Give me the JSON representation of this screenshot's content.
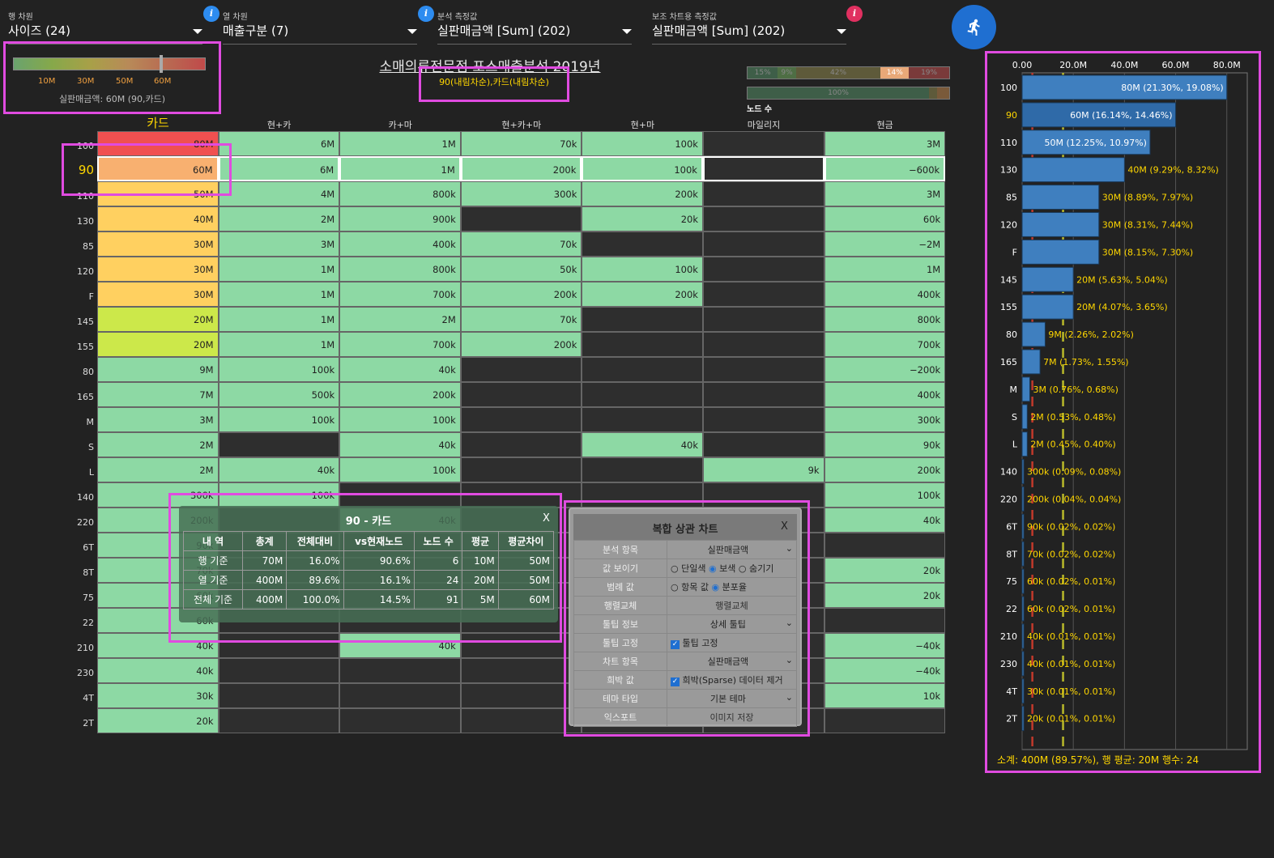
{
  "selectors": [
    {
      "label": "행 차원",
      "value": "사이즈 (24)"
    },
    {
      "label": "열 차원",
      "value": "매출구분 (7)"
    },
    {
      "label": "분석 측정값",
      "value": "실판매금액 [Sum] (202)"
    },
    {
      "label": "보조 차트용 측정값",
      "value": "실판매금액 [Sum] (202)"
    }
  ],
  "info_icon": "i",
  "legend": {
    "ticks": [
      "10M",
      "30M",
      "50M",
      "60M"
    ],
    "caption": "실판매금액: 60M (90,카드)",
    "marker": 0.78
  },
  "title": "소매의류전문점 포스매출분석 2019년",
  "sort_label": "90(내림차순),카드(내림차순)",
  "mini_bar1": [
    "15%",
    "9%",
    "42%",
    "14%",
    "19%"
  ],
  "mini_bar2": [
    "100%"
  ],
  "node_count_label": "노드 수",
  "columns": [
    "카드",
    "현+카",
    "카+마",
    "현+카+마",
    "현+마",
    "마일리지",
    "현금"
  ],
  "rows": [
    {
      "l": "100",
      "v": [
        "80M",
        "6M",
        "1M",
        "70k",
        "100k",
        "",
        "3M"
      ]
    },
    {
      "l": "90",
      "v": [
        "60M",
        "6M",
        "1M",
        "200k",
        "100k",
        "",
        "−600k"
      ]
    },
    {
      "l": "110",
      "v": [
        "50M",
        "4M",
        "800k",
        "300k",
        "200k",
        "",
        "3M"
      ]
    },
    {
      "l": "130",
      "v": [
        "40M",
        "2M",
        "900k",
        "",
        "20k",
        "",
        "60k"
      ]
    },
    {
      "l": "85",
      "v": [
        "30M",
        "3M",
        "400k",
        "70k",
        "",
        "",
        "−2M"
      ]
    },
    {
      "l": "120",
      "v": [
        "30M",
        "1M",
        "800k",
        "50k",
        "100k",
        "",
        "1M"
      ]
    },
    {
      "l": "F",
      "v": [
        "30M",
        "1M",
        "700k",
        "200k",
        "200k",
        "",
        "400k"
      ]
    },
    {
      "l": "145",
      "v": [
        "20M",
        "1M",
        "2M",
        "70k",
        "",
        "",
        "800k"
      ]
    },
    {
      "l": "155",
      "v": [
        "20M",
        "1M",
        "700k",
        "200k",
        "",
        "",
        "700k"
      ]
    },
    {
      "l": "80",
      "v": [
        "9M",
        "100k",
        "40k",
        "",
        "",
        "",
        "−200k"
      ]
    },
    {
      "l": "165",
      "v": [
        "7M",
        "500k",
        "200k",
        "",
        "",
        "",
        "400k"
      ]
    },
    {
      "l": "M",
      "v": [
        "3M",
        "100k",
        "100k",
        "",
        "",
        "",
        "300k"
      ]
    },
    {
      "l": "S",
      "v": [
        "2M",
        "",
        "40k",
        "",
        "40k",
        "",
        "90k"
      ]
    },
    {
      "l": "L",
      "v": [
        "2M",
        "40k",
        "100k",
        "",
        "",
        "9k",
        "200k"
      ]
    },
    {
      "l": "140",
      "v": [
        "300k",
        "100k",
        "",
        "",
        "",
        "",
        "100k"
      ]
    },
    {
      "l": "220",
      "v": [
        "200k",
        "",
        "40k",
        "",
        "",
        "",
        "40k"
      ]
    },
    {
      "l": "6T",
      "v": [
        "90k",
        "",
        "",
        "",
        "",
        "",
        ""
      ]
    },
    {
      "l": "8T",
      "v": [
        "70k",
        "",
        "",
        "",
        "",
        "",
        "20k"
      ]
    },
    {
      "l": "75",
      "v": [
        "60k",
        "",
        "",
        "",
        "",
        "",
        "20k"
      ]
    },
    {
      "l": "22",
      "v": [
        "60k",
        "",
        "",
        "",
        "",
        "",
        ""
      ]
    },
    {
      "l": "210",
      "v": [
        "40k",
        "",
        "40k",
        "",
        "",
        "",
        "−40k"
      ]
    },
    {
      "l": "230",
      "v": [
        "40k",
        "",
        "",
        "",
        "",
        "",
        "−40k"
      ]
    },
    {
      "l": "4T",
      "v": [
        "30k",
        "",
        "",
        "",
        "",
        "",
        "10k"
      ]
    },
    {
      "l": "2T",
      "v": [
        "20k",
        "",
        "",
        "",
        "",
        "",
        ""
      ]
    }
  ],
  "tooltip": {
    "title": "90 - 카드",
    "close": "X",
    "headers": [
      "내 역",
      "총계",
      "전체대비",
      "vs현재노드",
      "노드 수",
      "평균",
      "평균차이"
    ],
    "rows": [
      [
        "행 기준",
        "70M",
        "16.0%",
        "90.6%",
        "6",
        "10M",
        "50M"
      ],
      [
        "열 기준",
        "400M",
        "89.6%",
        "16.1%",
        "24",
        "20M",
        "50M"
      ],
      [
        "전체 기준",
        "400M",
        "100.0%",
        "14.5%",
        "91",
        "5M",
        "60M"
      ]
    ]
  },
  "panel": {
    "title": "복합 상관 차트",
    "close": "X",
    "r_analysis": "분석 항목",
    "analysis": "실판매금액",
    "r_show": "값 보이기",
    "show_opts": [
      "단일색",
      "보색",
      "숨기기"
    ],
    "r_legend": "범례 값",
    "legend_opts": [
      "항목 값",
      "분포율"
    ],
    "r_swap": "행렬교체",
    "swap": "행렬교체",
    "r_tip": "툴팁 정보",
    "tip": "상세 툴팁",
    "r_fix": "툴팁 고정",
    "fix": "툴팁 고정",
    "r_chart": "차트 항목",
    "chart": "실판매금액",
    "r_sparse": "희박 값",
    "sparse": "희박(Sparse) 데이터 제거",
    "r_theme": "테마 타입",
    "theme": "기본 테마",
    "r_export": "익스포트",
    "export": "이미지 저장"
  },
  "chart_data": {
    "type": "bar",
    "orientation": "horizontal",
    "x_ticks": [
      "0.00",
      "20.0M",
      "40.0M",
      "60.0M",
      "80.0M"
    ],
    "xlim": [
      0,
      88
    ],
    "categories": [
      "100",
      "90",
      "110",
      "130",
      "85",
      "120",
      "F",
      "145",
      "155",
      "80",
      "165",
      "M",
      "S",
      "L",
      "140",
      "220",
      "6T",
      "8T",
      "75",
      "22",
      "210",
      "230",
      "4T",
      "2T"
    ],
    "values": [
      80,
      60,
      50,
      40,
      30,
      30,
      30,
      20,
      20,
      9,
      7,
      3,
      2,
      2,
      0.3,
      0.2,
      0.09,
      0.07,
      0.06,
      0.06,
      0.04,
      0.04,
      0.03,
      0.02
    ],
    "labels": [
      "80M (21.30%, 19.08%)",
      "60M (16.14%, 14.46%)",
      "50M (12.25%, 10.97%)",
      "40M (9.29%, 8.32%)",
      "30M (8.89%, 7.97%)",
      "30M (8.31%, 7.44%)",
      "30M (8.15%, 7.30%)",
      "20M (5.63%, 5.04%)",
      "20M (4.07%, 3.65%)",
      "9M (2.26%, 2.02%)",
      "7M (1.73%, 1.55%)",
      "3M (0.76%, 0.68%)",
      "2M (0.53%, 0.48%)",
      "2M (0.45%, 0.40%)",
      "300k (0.09%, 0.08%)",
      "200k (0.04%, 0.04%)",
      "90k (0.02%, 0.02%)",
      "70k (0.02%, 0.02%)",
      "60k (0.02%, 0.01%)",
      "60k (0.02%, 0.01%)",
      "40k (0.01%, 0.01%)",
      "40k (0.01%, 0.01%)",
      "30k (0.01%, 0.01%)",
      "20k (0.01%, 0.01%)"
    ],
    "ref_lines": [
      {
        "value": 4,
        "color": "#c0392b"
      },
      {
        "value": 16,
        "color": "#b9b92a"
      }
    ],
    "summary": "소계: 400M (89.57%), 행 평균: 20M 행수: 24"
  },
  "colors": {
    "accent": "#e04be0",
    "green": "#8dd9a4",
    "bar": "#3f7fbf",
    "yellow": "#ffd700"
  }
}
